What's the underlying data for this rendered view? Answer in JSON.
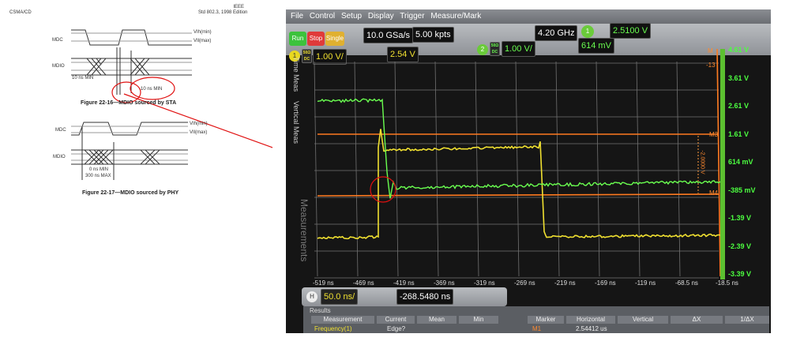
{
  "document": {
    "header_left": "CSMA/CD",
    "header_right_line1": "IEEE",
    "header_right_line2": "Std 802.3, 1998 Edition",
    "fig16": {
      "signal_mdc": "MDC",
      "signal_mdio": "MDIO",
      "vih": "VIh(min)",
      "vil": "VIl(max)",
      "setup_label": "10 ns MIN",
      "hold_label": "10 ns MIN",
      "caption": "Figure 22-16—MDIO sourced by STA"
    },
    "fig17": {
      "signal_mdc": "MDC",
      "signal_mdio": "MDIO",
      "vih": "VIh(min)",
      "vil": "VIl(max)",
      "delay_min": "0 ns  MIN",
      "delay_max": "300 ns MAX",
      "caption": "Figure 22-17—MDIO sourced by PHY"
    }
  },
  "scope": {
    "menu": [
      "File",
      "Control",
      "Setup",
      "Display",
      "Trigger",
      "Measure/Mark"
    ],
    "run": "Run",
    "stop": "Stop",
    "single": "Single",
    "sample_rate": "10.0 GSa/s",
    "memory_depth": "5.00 kpts",
    "bandwidth": "4.20 GHz",
    "trigger_channel": "1",
    "trigger_level": "2.5100 V",
    "ch1": {
      "num": "1",
      "coupling": "50Ω DC",
      "scale": "1.00 V/",
      "offset": "2.54 V",
      "color": "#f0e030"
    },
    "ch2": {
      "num": "2",
      "coupling": "50Ω DC",
      "scale": "1.00 V/",
      "offset": "614 mV",
      "color": "#6aff50"
    },
    "side_tabs": [
      "Time Meas",
      "Vertical Meas",
      "Measurements"
    ],
    "y_ticks": [
      "4.61 V",
      "3.61 V",
      "2.61 V",
      "1.61 V",
      "614 mV",
      "-385 mV",
      "-1.39 V",
      "-2.39 V",
      "-3.39 V"
    ],
    "x_ticks": [
      "-519 ns",
      "-469 ns",
      "-419 ns",
      "-369 ns",
      "-319 ns",
      "-269 ns",
      "-219 ns",
      "-169 ns",
      "-119 ns",
      "-68.5 ns",
      "-18.5 ns"
    ],
    "marker_labels": {
      "m3": "M3",
      "m4": "M4",
      "m": "M",
      "m_val": "-13",
      "delta": "-2.0000 V"
    },
    "timebase": {
      "badge": "H",
      "scale": "50.0 ns/",
      "position": "-268.5480 ns"
    },
    "results": {
      "title": "Results",
      "meas_headers": [
        "Measurement",
        "Current",
        "Mean",
        "Min"
      ],
      "meas_row": {
        "name": "Frequency(1)",
        "current": "Edge?"
      },
      "marker_headers": [
        "Marker",
        "Horizontal",
        "Vertical",
        "ΔX",
        "1/ΔX"
      ],
      "marker_row": {
        "name": "M1",
        "horizontal": "2.54412 us"
      }
    }
  }
}
